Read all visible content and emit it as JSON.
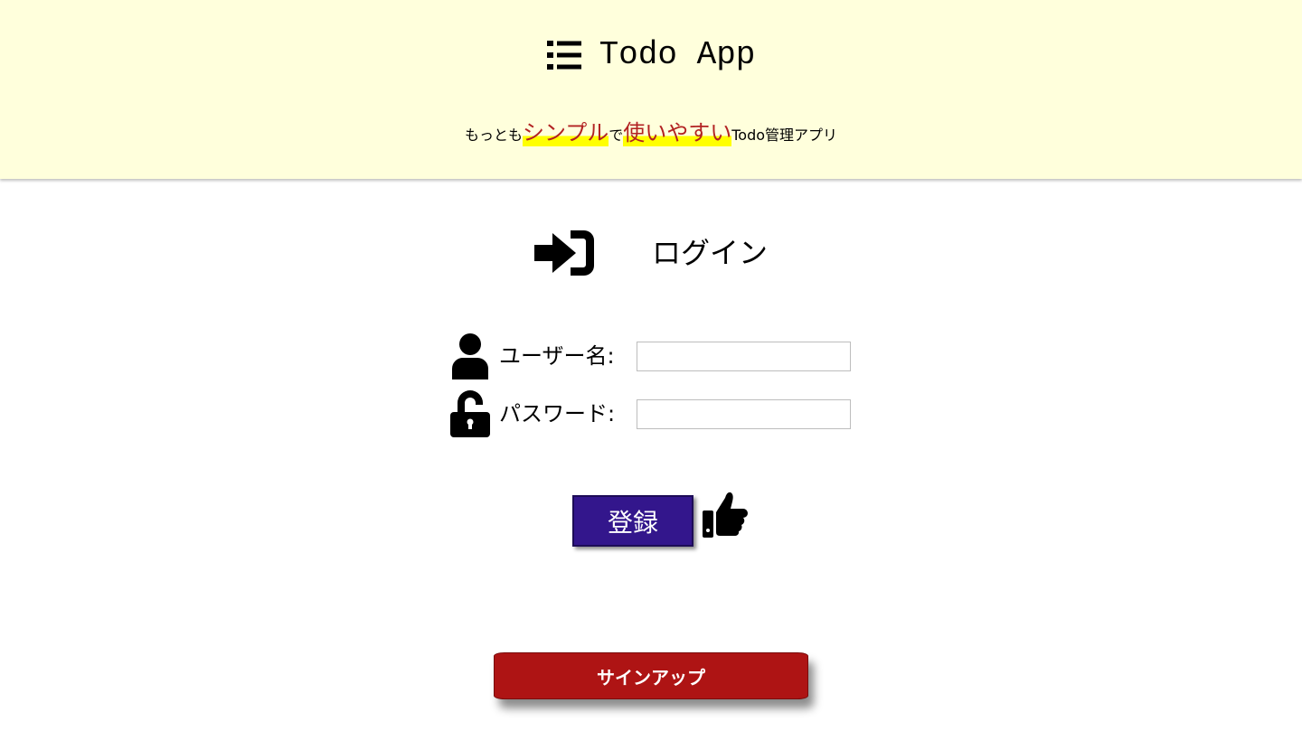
{
  "header": {
    "app_title": "Todo App",
    "app_icon": "list-icon",
    "tagline": {
      "part1": "もっとも",
      "highlight1": "シンプル",
      "part2": "で",
      "highlight2": "使いやすい",
      "part3": "Todo管理アプリ"
    },
    "background_color": "#ffffdc",
    "highlight_text_color": "#b22222",
    "highlight_marker_color": "#ffff00"
  },
  "login": {
    "heading": "ログイン",
    "heading_icon": "sign-in-icon",
    "username_label": "ユーザー名:",
    "username_icon": "user-icon",
    "username_value": "",
    "password_label": "パスワード:",
    "password_icon": "unlock-icon",
    "password_value": "",
    "submit_label": "登録",
    "submit_color": "#33168c",
    "submit_icon": "thumbs-up-icon"
  },
  "signup": {
    "label": "サインアップ",
    "color": "#ae1414"
  }
}
